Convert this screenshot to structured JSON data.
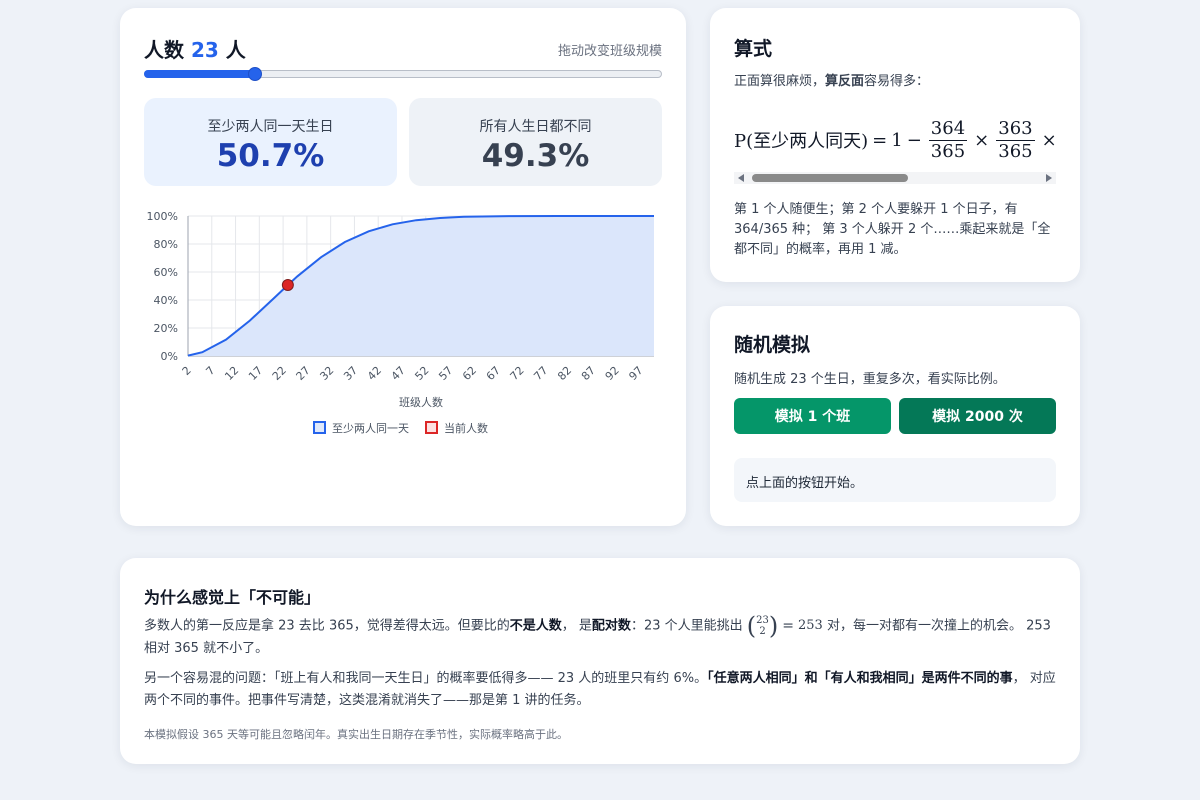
{
  "class_size": {
    "title_prefix": "人数",
    "value": "23",
    "title_suffix": "人",
    "slider_hint": "拖动改变班级规模",
    "slider_min": 2,
    "slider_max": 100,
    "slider_value": 23
  },
  "stats": {
    "shared": {
      "label": "至少两人同一天生日",
      "value": "50.7%"
    },
    "distinct": {
      "label": "所有人生日都不同",
      "value": "49.3%"
    }
  },
  "chart_data": {
    "type": "line",
    "xlabel": "班级人数",
    "ylabel": "",
    "x_ticks": [
      "2",
      "7",
      "12",
      "17",
      "22",
      "27",
      "32",
      "37",
      "42",
      "47",
      "52",
      "57",
      "62",
      "67",
      "72",
      "77",
      "82",
      "87",
      "92",
      "97"
    ],
    "y_ticks": [
      "0%",
      "20%",
      "40%",
      "60%",
      "80%",
      "100%"
    ],
    "xlim": [
      2,
      100
    ],
    "ylim": [
      0,
      1
    ],
    "series": [
      {
        "name": "至少两人同一天",
        "color": "#2563eb",
        "fill": "#dbe6fb",
        "x": [
          2,
          5,
          10,
          15,
          20,
          23,
          25,
          30,
          35,
          40,
          45,
          50,
          55,
          60,
          70,
          80,
          100
        ],
        "y": [
          0.003,
          0.027,
          0.117,
          0.253,
          0.411,
          0.507,
          0.569,
          0.706,
          0.814,
          0.891,
          0.941,
          0.97,
          0.986,
          0.994,
          0.999,
          1.0,
          1.0
        ]
      }
    ],
    "marker": {
      "name": "当前人数",
      "x": 23,
      "y": 0.507,
      "color": "#dc2626"
    },
    "legend_position": "bottom",
    "grid": true
  },
  "formula": {
    "title": "算式",
    "intro_prefix": "正面算很麻烦，",
    "intro_bold": "算反面",
    "intro_suffix": "容易得多：",
    "lhs": "P(至少两人同天)",
    "eq": "=",
    "one": "1",
    "minus": "−",
    "times": "×",
    "frac1_num": "364",
    "frac1_den": "365",
    "frac2_num": "363",
    "frac2_den": "365",
    "explanation": "第 1 个人随便生；第 2 个人要躲开 1 个日子，有 364/365 种； 第 3 个人躲开 2 个……乘起来就是「全都不同」的概率，再用 1 减。"
  },
  "simulation": {
    "title": "随机模拟",
    "intro": "随机生成 23 个生日，重复多次，看实际比例。",
    "btn_one": "模拟 1 个班",
    "btn_many": "模拟 2000 次",
    "result": "点上面的按钮开始。"
  },
  "why": {
    "title": "为什么感觉上「不可能」",
    "p1_a": "多数人的第一反应是拿 23 去比 365，觉得差得太远。但要比的",
    "p1_b1": "不是人数",
    "p1_c": "， 是",
    "p1_b2": "配对数",
    "p1_d": "：23 个人里能挑出",
    "binom_top": "23",
    "binom_bottom": "2",
    "binom_eq": "=",
    "binom_val": "253",
    "p1_e": "对，每一对都有一次撞上的机会。 253 相对 365 就不小了。",
    "p2_a": "另一个容易混的问题：「班上有人和我同一天生日」的概率要低得多—— 23 人的班里只有约 6%。",
    "p2_b": "「任意两人相同」和「有人和我相同」是两件不同的事",
    "p2_c": "， 对应两个不同的事件。把事件写清楚，这类混淆就消失了——那是第 1 讲的任务。",
    "note": "本模拟假设 365 天等可能且忽略闰年。真实出生日期存在季节性，实际概率略高于此。"
  }
}
